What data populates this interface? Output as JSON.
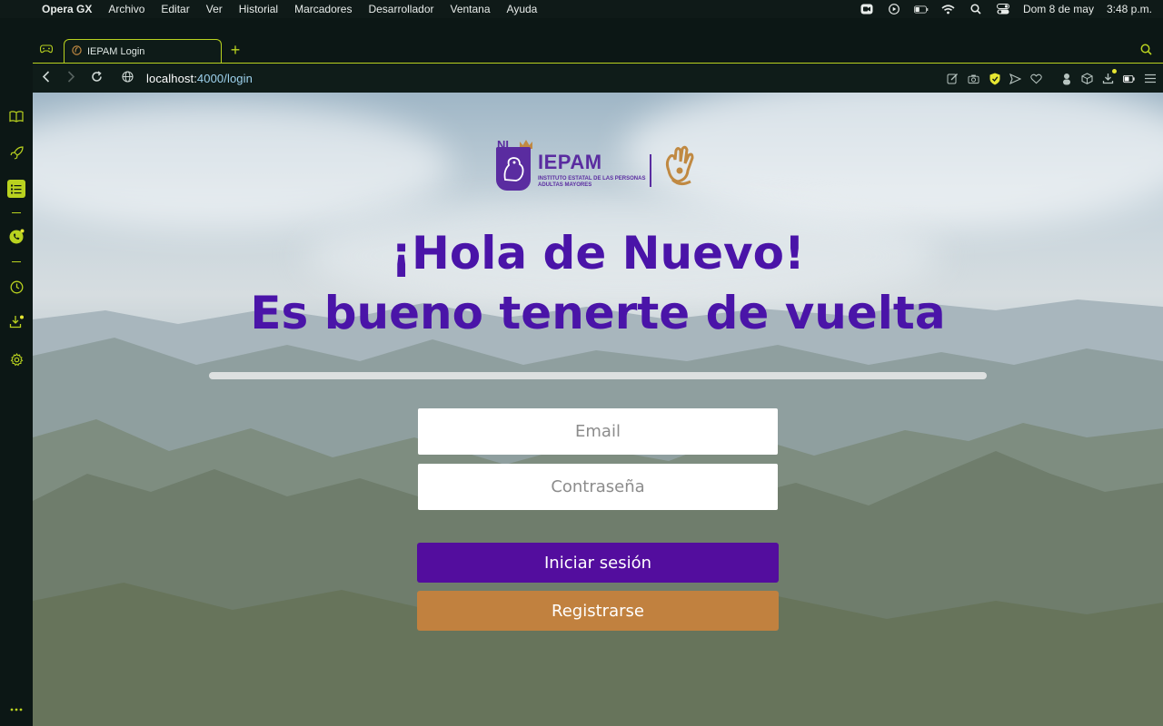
{
  "menubar": {
    "app": "Opera GX",
    "items": [
      "Archivo",
      "Editar",
      "Ver",
      "Historial",
      "Marcadores",
      "Desarrollador",
      "Ventana",
      "Ayuda"
    ],
    "date": "Dom 8 de may",
    "time": "3:48 p.m."
  },
  "browser": {
    "tab_title": "IEPAM Login",
    "url_host": "localhost:",
    "url_path": "4000/login",
    "accent": "#b9d21f"
  },
  "page": {
    "logo": {
      "nl": "NL",
      "title": "IEPAM",
      "subtitle": "INSTITUTO ESTATAL DE LAS PERSONAS ADULTAS MAYORES"
    },
    "greeting_line1": "¡Hola de Nuevo!",
    "greeting_line2": "Es bueno tenerte de vuelta",
    "email_placeholder": "Email",
    "password_placeholder": "Contraseña",
    "login_label": "Iniciar sesión",
    "register_label": "Registrarse",
    "colors": {
      "primary": "#4a14a8",
      "login_button": "#530d9e",
      "register_button": "#c1813f"
    }
  }
}
